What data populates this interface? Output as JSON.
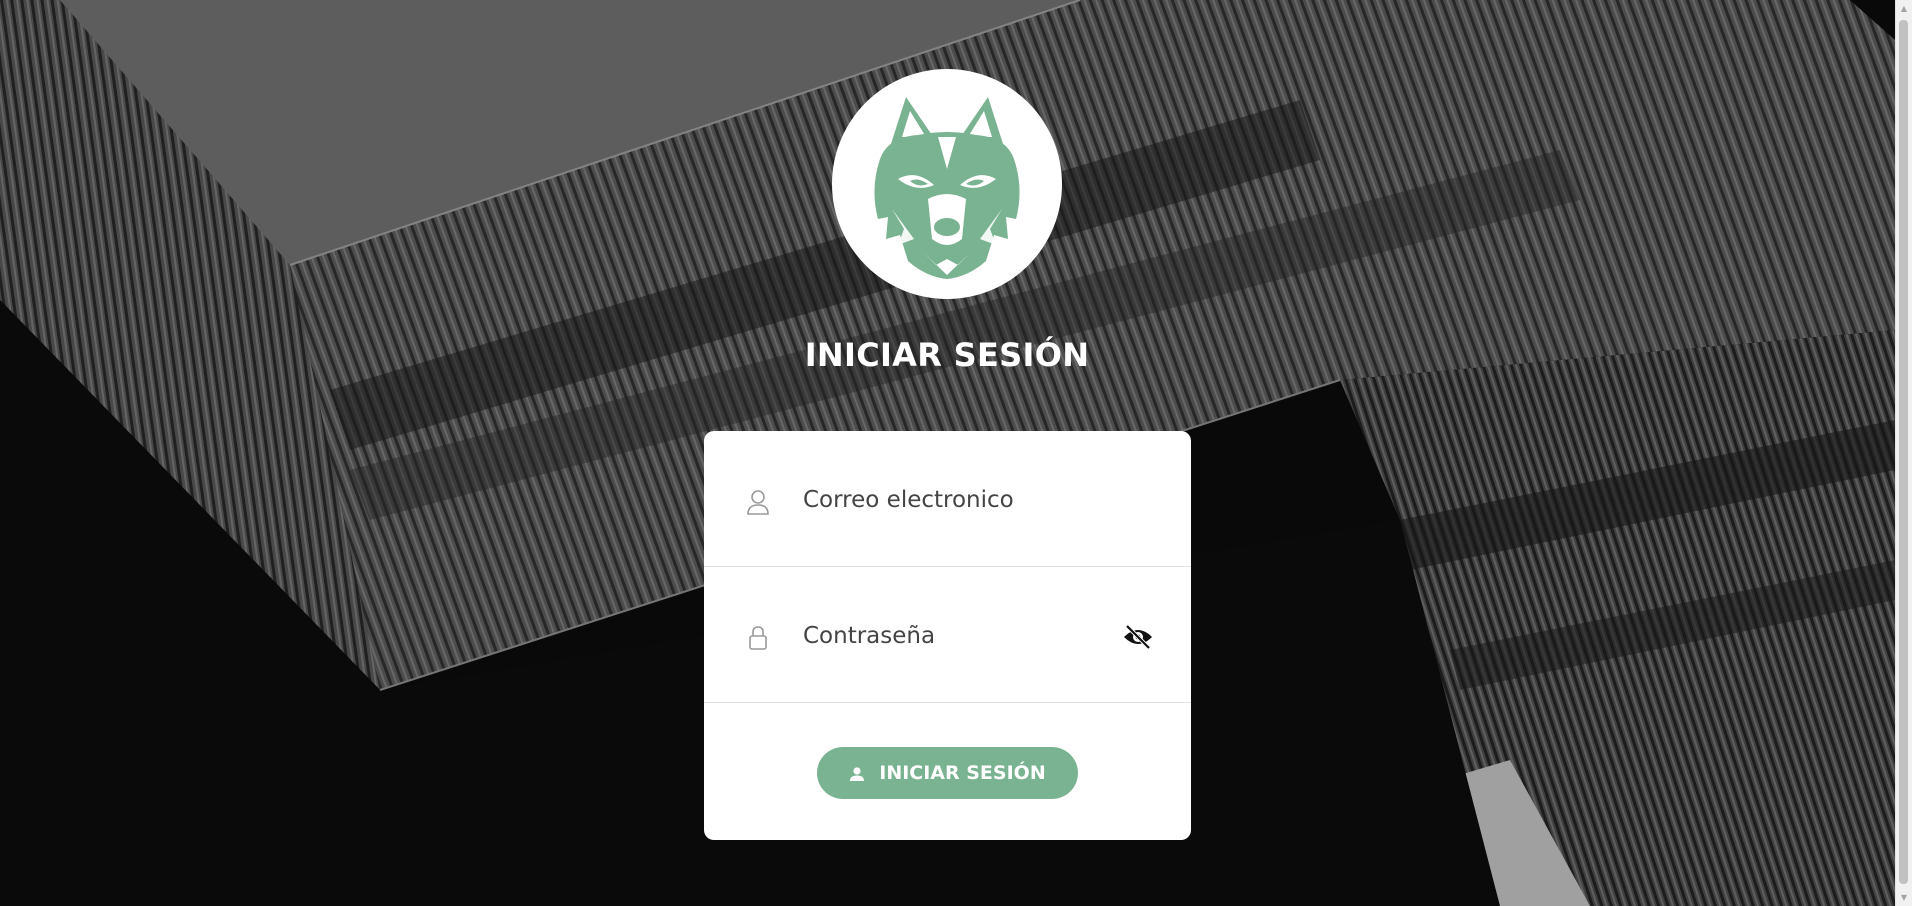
{
  "login": {
    "title": "INICIAR SESIÓN",
    "email_placeholder": "Correo electronico",
    "password_placeholder": "Contraseña",
    "submit_label": "INICIAR SESIÓN"
  },
  "icons": {
    "logo": "wolf-head-logo",
    "email": "user-icon",
    "password": "lock-icon",
    "toggle": "eye-slash-icon",
    "submit": "user-icon"
  },
  "colors": {
    "accent": "#7ab391",
    "card": "#ffffff",
    "title": "#ffffff"
  }
}
